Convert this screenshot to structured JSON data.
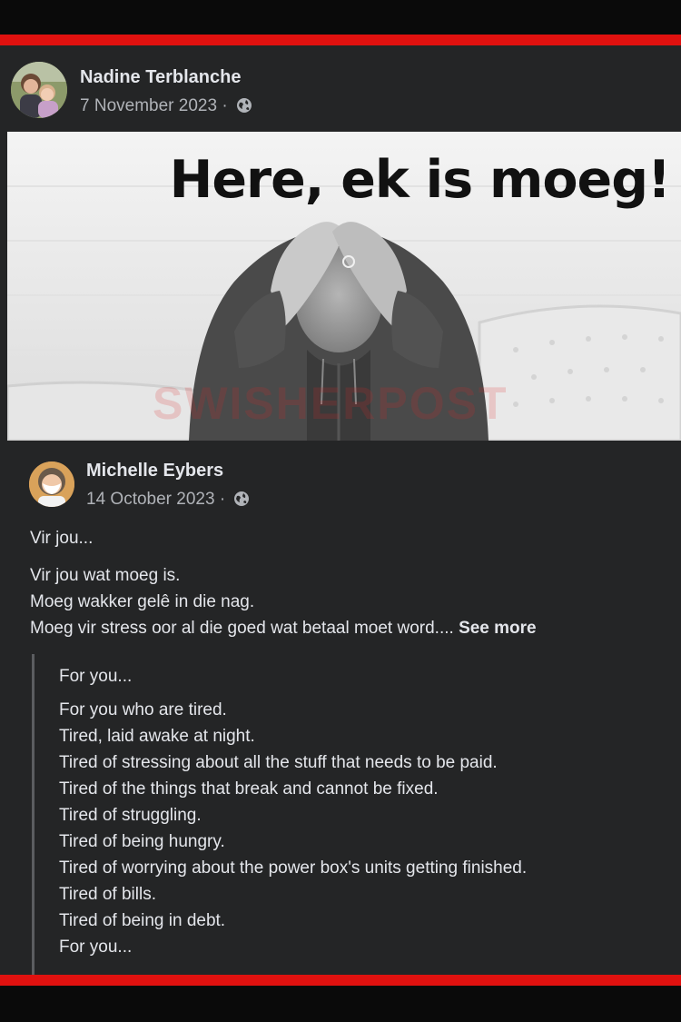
{
  "post": {
    "author": "Nadine Terblanche",
    "date": "7 November 2023",
    "date_separator": " ·",
    "audience_icon": "globe-icon"
  },
  "image": {
    "headline": "Here, ek is moeg!",
    "watermark": "SWISHERPOST"
  },
  "shared_post": {
    "author": "Michelle Eybers",
    "date": "14 October 2023",
    "date_separator": " ·",
    "audience_icon": "globe-icon",
    "intro": "Vir jou...",
    "lines": [
      "Vir jou wat moeg is.",
      "Moeg wakker gelê in die nag.",
      "Moeg vir stress oor al die goed wat betaal moet word.... "
    ],
    "see_more": "See more"
  },
  "translation": {
    "intro": "For you...",
    "lines": [
      "For you who are tired.",
      "Tired, laid awake at night.",
      "Tired of stressing about all the stuff that needs to be paid.",
      "Tired of the things that break and cannot be fixed.",
      "Tired of struggling.",
      "Tired of being hungry.",
      "Tired of worrying about the power box's units getting finished.",
      "Tired of bills.",
      "Tired of being in debt.",
      "For you..."
    ]
  },
  "colors": {
    "frame_red": "#e0110f",
    "card_bg": "#242526",
    "text_primary": "#e4e6eb",
    "text_secondary": "#b0b3b8"
  }
}
